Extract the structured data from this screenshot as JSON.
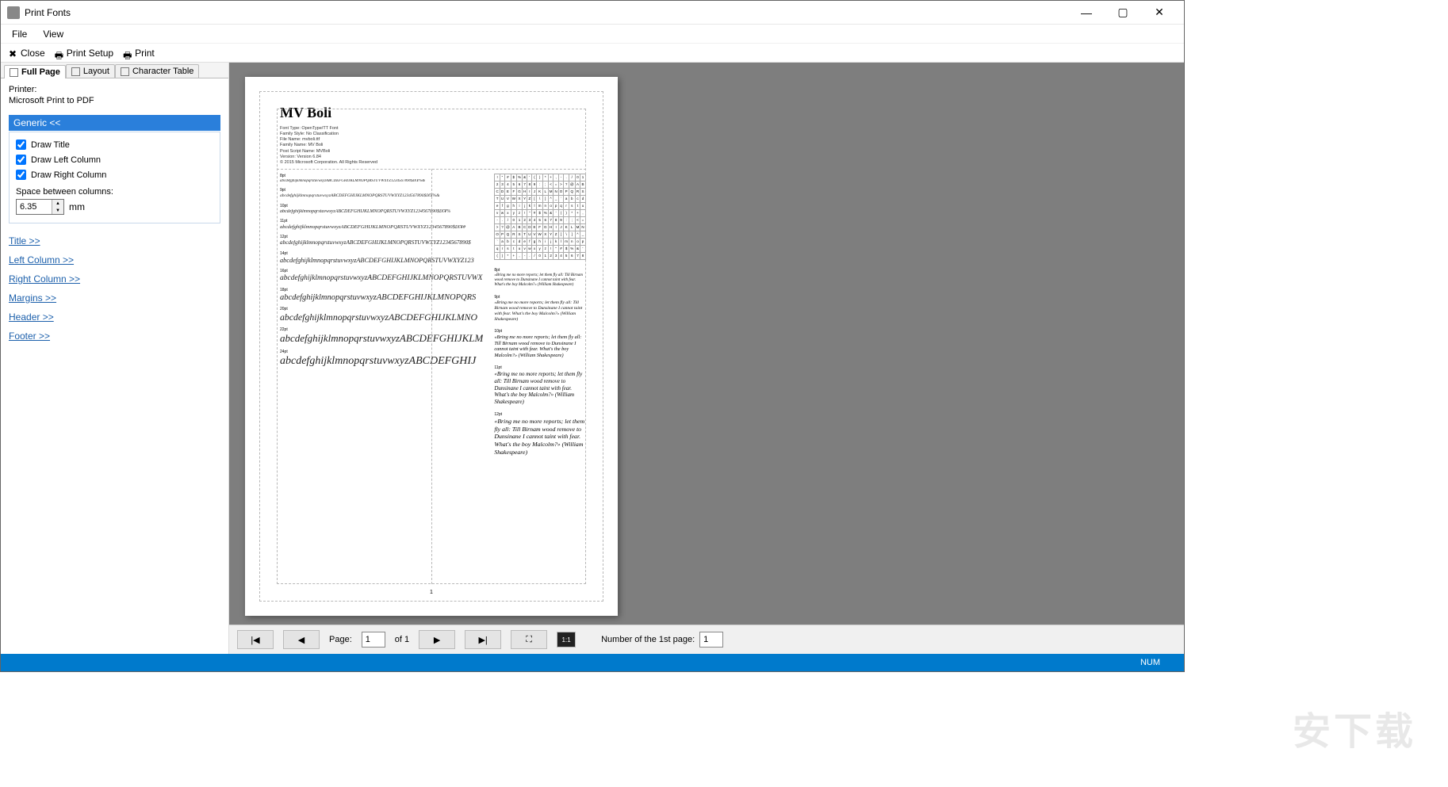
{
  "window": {
    "title": "Print Fonts"
  },
  "menu": {
    "file": "File",
    "view": "View"
  },
  "toolbar": {
    "close": "Close",
    "printSetup": "Print Setup",
    "print": "Print"
  },
  "tabs": {
    "fullPage": "Full Page",
    "layout": "Layout",
    "charTable": "Character Table"
  },
  "printer": {
    "label": "Printer:",
    "name": "Microsoft Print to PDF"
  },
  "generic": {
    "header": "Generic <<",
    "drawTitle": "Draw Title",
    "drawLeft": "Draw Left Column",
    "drawRight": "Draw Right Column",
    "spacingLabel": "Space between columns:",
    "spacingValue": "6.35",
    "spacingUnit": "mm"
  },
  "links": {
    "title": "Title >>",
    "left": "Left Column >>",
    "right": "Right Column >>",
    "margins": "Margins >>",
    "header": "Header >>",
    "footer": "Footer >>"
  },
  "preview": {
    "fontTitle": "MV Boli",
    "meta": [
      "Font Type: OpenType/TT Font",
      "Family Style: No Classification",
      "File Name: mvboli.ttf",
      "Family Name: MV Boli",
      "Post Script Name: MVBoli",
      "Version: Version 6.84",
      "© 2015 Microsoft Corporation. All Rights Reserved"
    ],
    "leftSamples": [
      {
        "pt": "8pt",
        "size": 5,
        "txt": "abcdefghijklmnopqrstuvwxyzABCDEFGHIJKLMNOPQRSTUVWXYZ1234567890$£€¥%&"
      },
      {
        "pt": "9pt",
        "size": 5.5,
        "txt": "abcdefghijklmnopqrstuvwxyzABCDEFGHIJKLMNOPQRSTUVWXYZ1234567890$£€¥%&"
      },
      {
        "pt": "10pt",
        "size": 6,
        "txt": "abcdefghijklmnopqrstuvwxyzABCDEFGHIJKLMNOPQRSTUVWXYZ1234567890$£€¥%"
      },
      {
        "pt": "11pt",
        "size": 6.6,
        "txt": "abcdefghijklmnopqrstuvwxyzABCDEFGHIJKLMNOPQRSTUVWXYZ1234567890$£€¥#"
      },
      {
        "pt": "12pt",
        "size": 7.2,
        "txt": "abcdefghijklmnopqrstuvwxyzABCDEFGHIJKLMNOPQRSTUVWXYZ1234567890$"
      },
      {
        "pt": "14pt",
        "size": 8.3,
        "txt": "abcdefghijklmnopqrstuvwxyzABCDEFGHIJKLMNOPQRSTUVWXYZ123"
      },
      {
        "pt": "16pt",
        "size": 9.5,
        "txt": "abcdefghijklmnopqrstuvwxyzABCDEFGHIJKLMNOPQRSTUVWX"
      },
      {
        "pt": "18pt",
        "size": 10.5,
        "txt": "abcdefghijklmnopqrstuvwxyzABCDEFGHIJKLMNOPQRS"
      },
      {
        "pt": "20pt",
        "size": 11.8,
        "txt": "abcdefghijklmnopqrstuvwxyzABCDEFGHIJKLMNO"
      },
      {
        "pt": "22pt",
        "size": 13,
        "txt": "abcdefghijklmnopqrstuvwxyzABCDEFGHIJKLM"
      },
      {
        "pt": "24pt",
        "size": 14,
        "txt": "abcdefghijklmnopqrstuvwxyzABCDEFGHIJ"
      }
    ],
    "quotes": [
      {
        "pt": "8pt",
        "size": 5,
        "txt": "«Bring me no more reports; let them fly all: Till Birnam wood remove to Dunsinane I cannot taint with fear. What's the boy Malcolm?» (William Shakespeare)"
      },
      {
        "pt": "9pt",
        "size": 5.6,
        "txt": "«Bring me no more reports; let them fly all: Till Birnam wood remove to Dunsinane I cannot taint with fear. What's the boy Malcolm?» (William Shakespeare)"
      },
      {
        "pt": "10pt",
        "size": 6.3,
        "txt": "«Bring me no more reports; let them fly all: Till Birnam wood remove to Dunsinane I cannot taint with fear. What's the boy Malcolm?» (William Shakespeare)"
      },
      {
        "pt": "11pt",
        "size": 7,
        "txt": "«Bring me no more reports; let them fly all: Till Birnam wood remove to Dunsinane I cannot taint with fear. What's the boy Malcolm?» (William Shakespeare)"
      },
      {
        "pt": "12pt",
        "size": 7.8,
        "txt": "«Bring me no more reports; let them fly all: Till Birnam wood remove to Dunsinane I cannot taint with fear. What's the boy Malcolm?» (William Shakespeare)"
      }
    ],
    "pageNum": "1"
  },
  "nav": {
    "pageLabel": "Page:",
    "pageVal": "1",
    "of": "of 1",
    "firstPageLabel": "Number of the 1st page:",
    "firstPageVal": "1",
    "ratio": "1:1"
  },
  "status": {
    "num": "NUM"
  },
  "watermark": "安下载"
}
